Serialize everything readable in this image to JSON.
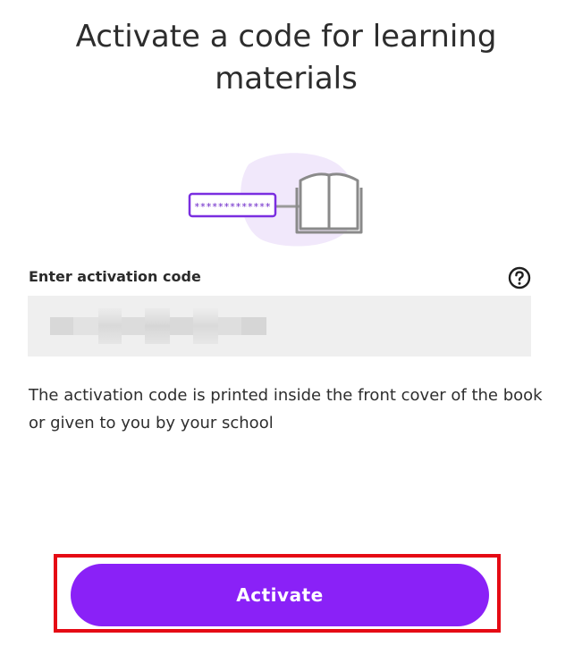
{
  "page": {
    "title": "Activate a code for learning materials"
  },
  "illustration": {
    "code_preview": "*************",
    "colors": {
      "blob": "#f1e8fb",
      "code_border": "#7a2ee0",
      "book": "#8a8a8a"
    }
  },
  "form": {
    "label": "Enter activation code",
    "help_icon": "question-circle-icon",
    "value": "",
    "placeholder": "",
    "hint": "The activation code is printed inside the front cover of the book or given to you by your school"
  },
  "actions": {
    "activate_label": "Activate",
    "accent_color": "#8a21f7",
    "highlight_color": "#e50a14"
  }
}
